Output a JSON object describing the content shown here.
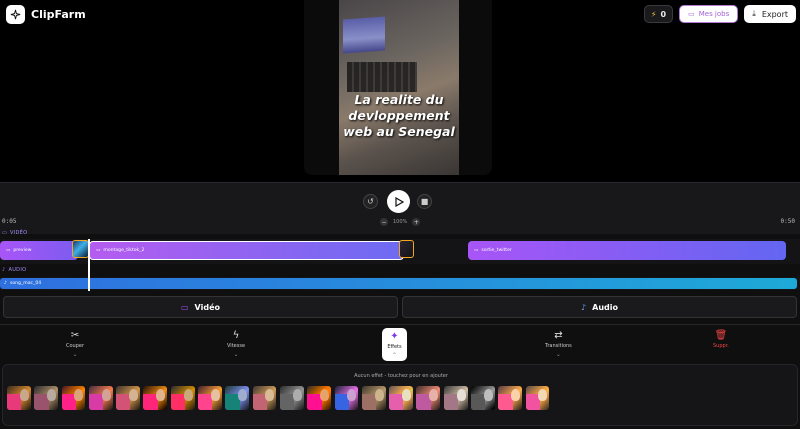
{
  "app": {
    "title": "ClipFarm"
  },
  "header": {
    "credits": "0",
    "jobs_label": "Mes jobs",
    "export_label": "Export"
  },
  "video": {
    "caption": "La realite du devloppement web au Senegal"
  },
  "timeline": {
    "time_start": "0:05",
    "time_end": "0:50",
    "zoom_label": "100%",
    "video_track_label": "VIDÉO",
    "audio_track_label": "AUDIO",
    "clips": [
      {
        "name": "preview"
      },
      {
        "name": "montage_tiktok_2"
      },
      {
        "name": "sortie_twitter"
      }
    ],
    "audio_clip": "song_mac_04"
  },
  "tabs": {
    "video": "Vidéo",
    "audio": "Audio"
  },
  "tools": {
    "cut": "Couper",
    "speed": "Vitesse",
    "effects": "Effets",
    "transitions": "Transitions",
    "delete": "Suppr."
  },
  "effects": {
    "hint": "Aucun effet - touchez pour en ajouter",
    "count": 20
  },
  "colors": {
    "accent": "#7c3aed",
    "clip_gradient_start": "#a855f7",
    "clip_gradient_end": "#6366f1",
    "audio": "#2f6fe0",
    "delete": "#ef4444",
    "selection": "#f5a623"
  }
}
